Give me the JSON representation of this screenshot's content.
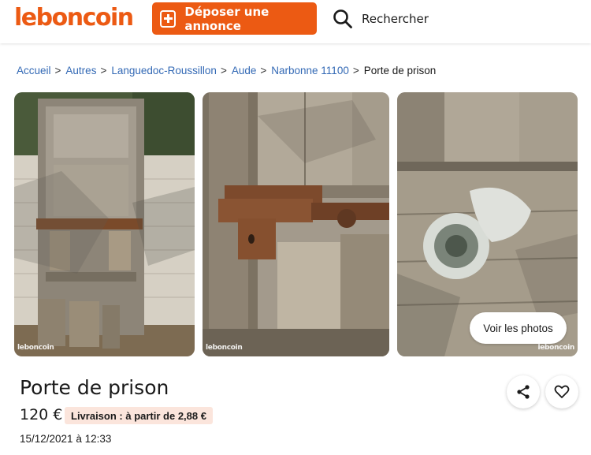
{
  "header": {
    "logo_text": "leboncoin",
    "deposit_label": "Déposer une annonce",
    "search_label": "Rechercher",
    "icons": [
      "plus-icon",
      "search-icon"
    ],
    "brand_color": "#ec5a13"
  },
  "breadcrumb": {
    "items": [
      "Accueil",
      "Autres",
      "Languedoc-Roussillon",
      "Aude",
      "Narbonne 11100"
    ],
    "separator": ">",
    "current": "Porte de prison"
  },
  "gallery": {
    "watermark": "leboncoin",
    "photos_button": "Voir les photos"
  },
  "listing": {
    "title": "Porte de prison",
    "price": "120 €",
    "delivery": "Livraison : à partir de 2,88 €",
    "date": "15/12/2021 à 12:33",
    "icons": [
      "share-icon",
      "heart-icon"
    ],
    "delivery_badge_color": "#fbe5dc"
  }
}
